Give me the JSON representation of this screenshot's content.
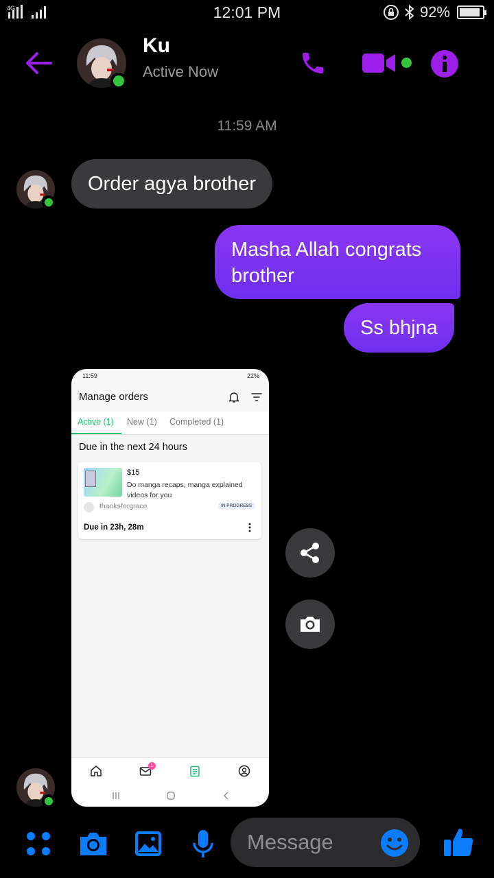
{
  "status_bar": {
    "network": "4G",
    "time": "12:01 PM",
    "battery_percent": "92%",
    "battery_level": 0.92
  },
  "header": {
    "back_icon": "arrow-left-icon",
    "contact_name": "Ku",
    "status": "Active Now",
    "call_icon": "phone-icon",
    "video_icon": "video-camera-icon",
    "info_icon": "info-icon"
  },
  "conversation": {
    "timestamp": "11:59 AM",
    "messages": [
      {
        "direction": "incoming",
        "text": "Order agya brother"
      },
      {
        "direction": "outgoing",
        "text": "Masha Allah congrats brother"
      },
      {
        "direction": "outgoing",
        "text": "Ss bhjna"
      }
    ]
  },
  "shared_screenshot": {
    "status_time": "11:59",
    "status_right": "22%",
    "title": "Manage orders",
    "tabs": [
      "Active (1)",
      "New (1)",
      "Completed (1)"
    ],
    "active_tab": 0,
    "section_title": "Due in the next 24 hours",
    "order": {
      "price": "$15",
      "description": "Do manga recaps, manga explained videos for you",
      "seller": "thanksforgrace",
      "badge": "IN PROGRESS",
      "due": "Due in 23h, 28m"
    },
    "nav_badge_count": "1"
  },
  "actions": {
    "share_icon": "share-icon",
    "camera_icon": "camera-icon"
  },
  "composer": {
    "apps_icon": "apps-grid-icon",
    "camera_icon": "camera-icon",
    "gallery_icon": "image-icon",
    "mic_icon": "microphone-icon",
    "placeholder": "Message",
    "emoji_icon": "smiley-icon",
    "like_icon": "thumbs-up-icon"
  },
  "colors": {
    "accent_purple": "#9b1fe8",
    "outgoing_bubble": "#7b33f1",
    "incoming_bubble": "#3a3a3c",
    "composer_blue": "#0a7cff",
    "online_green": "#34c540"
  }
}
